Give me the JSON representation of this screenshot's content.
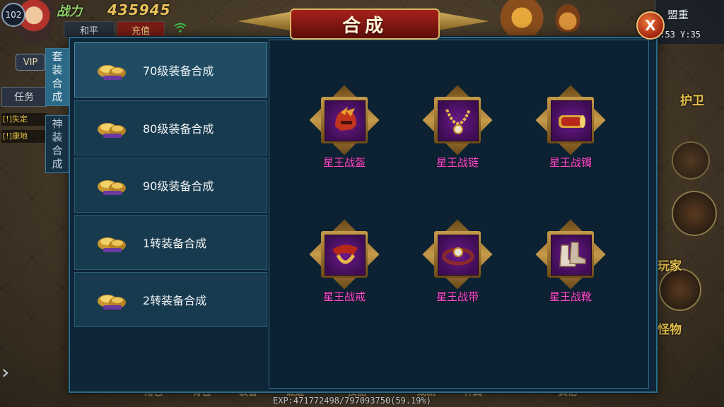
{
  "hud": {
    "level": "102",
    "power_label": "战力",
    "power_value": "435945",
    "mode_peace": "和平",
    "mode_charge": "充值",
    "vip": "VIP",
    "task_tab": "任务",
    "quests": [
      "[!]失定",
      "[!]康地"
    ],
    "alliance": "盟重",
    "coords": "X:53 Y:35",
    "guard_label": "护卫",
    "player_label": "玩家",
    "monster_label": "怪物",
    "bottom_nav": [
      "角色",
      "背包",
      "装备",
      "锻造",
      "技能",
      "成就",
      "神翼",
      "其他"
    ],
    "exp": "EXP:471772498/797093750(59.19%)"
  },
  "dialog": {
    "title": "合成",
    "close_glyph": "X",
    "side_tabs": [
      {
        "label": "套装合成",
        "active": true
      },
      {
        "label": "神装合成",
        "active": false
      }
    ],
    "categories": [
      {
        "label": "70级装备合成",
        "active": true
      },
      {
        "label": "80级装备合成",
        "active": false
      },
      {
        "label": "90级装备合成",
        "active": false
      },
      {
        "label": "1转装备合成",
        "active": false
      },
      {
        "label": "2转装备合成",
        "active": false
      }
    ],
    "items": [
      {
        "name": "星王战盔",
        "icon": "helmet-icon"
      },
      {
        "name": "星王战链",
        "icon": "necklace-icon"
      },
      {
        "name": "星王战镯",
        "icon": "bracelet-icon"
      },
      {
        "name": "星王战戒",
        "icon": "ring-icon"
      },
      {
        "name": "星王战带",
        "icon": "belt-icon"
      },
      {
        "name": "星王战靴",
        "icon": "boots-icon"
      }
    ]
  },
  "colors": {
    "item_name": "#ff4fd0",
    "panel_bg": "#0e2637",
    "title_plate": "#a6211a"
  }
}
